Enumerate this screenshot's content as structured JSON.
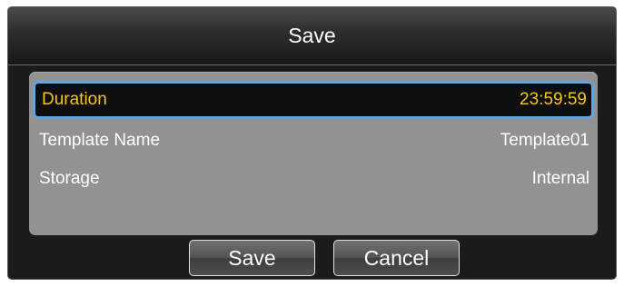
{
  "dialog": {
    "title": "Save",
    "rows": [
      {
        "label": "Duration",
        "value": "23:59:59",
        "selected": true
      },
      {
        "label": "Template Name",
        "value": "Template01",
        "selected": false
      },
      {
        "label": "Storage",
        "value": "Internal",
        "selected": false
      }
    ],
    "buttons": {
      "save": "Save",
      "cancel": "Cancel"
    }
  },
  "colors": {
    "selected_text": "#f5c518",
    "selection_border": "#5da6ea",
    "panel_background": "#929292",
    "dialog_background": "#1b1b1b"
  }
}
